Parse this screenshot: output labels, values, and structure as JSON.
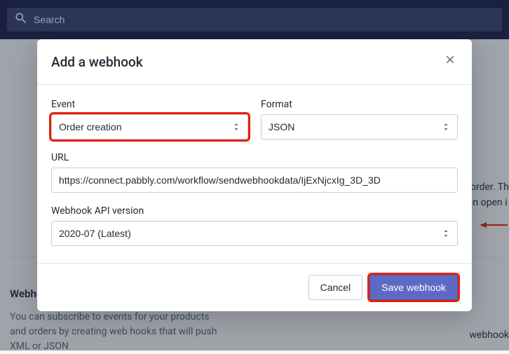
{
  "search": {
    "placeholder": "Search"
  },
  "modal": {
    "title": "Add a webhook",
    "fields": {
      "event": {
        "label": "Event",
        "value": "Order creation"
      },
      "format": {
        "label": "Format",
        "value": "JSON"
      },
      "url": {
        "label": "URL",
        "value": "https://connect.pabbly.com/workflow/sendwebhookdata/IjExNjcxIg_3D_3D"
      },
      "api_version": {
        "label": "Webhook API version",
        "value": "2020-07 (Latest)"
      }
    },
    "buttons": {
      "cancel": "Cancel",
      "save": "Save webhook"
    }
  },
  "bg": {
    "webhooks_heading": "Webhooks",
    "webhooks_desc": "You can subscribe to events for your products and orders by creating web hooks that will push XML or JSON",
    "snip1": "order. Th",
    "snip2": "in open i",
    "snip3": "webhook"
  }
}
